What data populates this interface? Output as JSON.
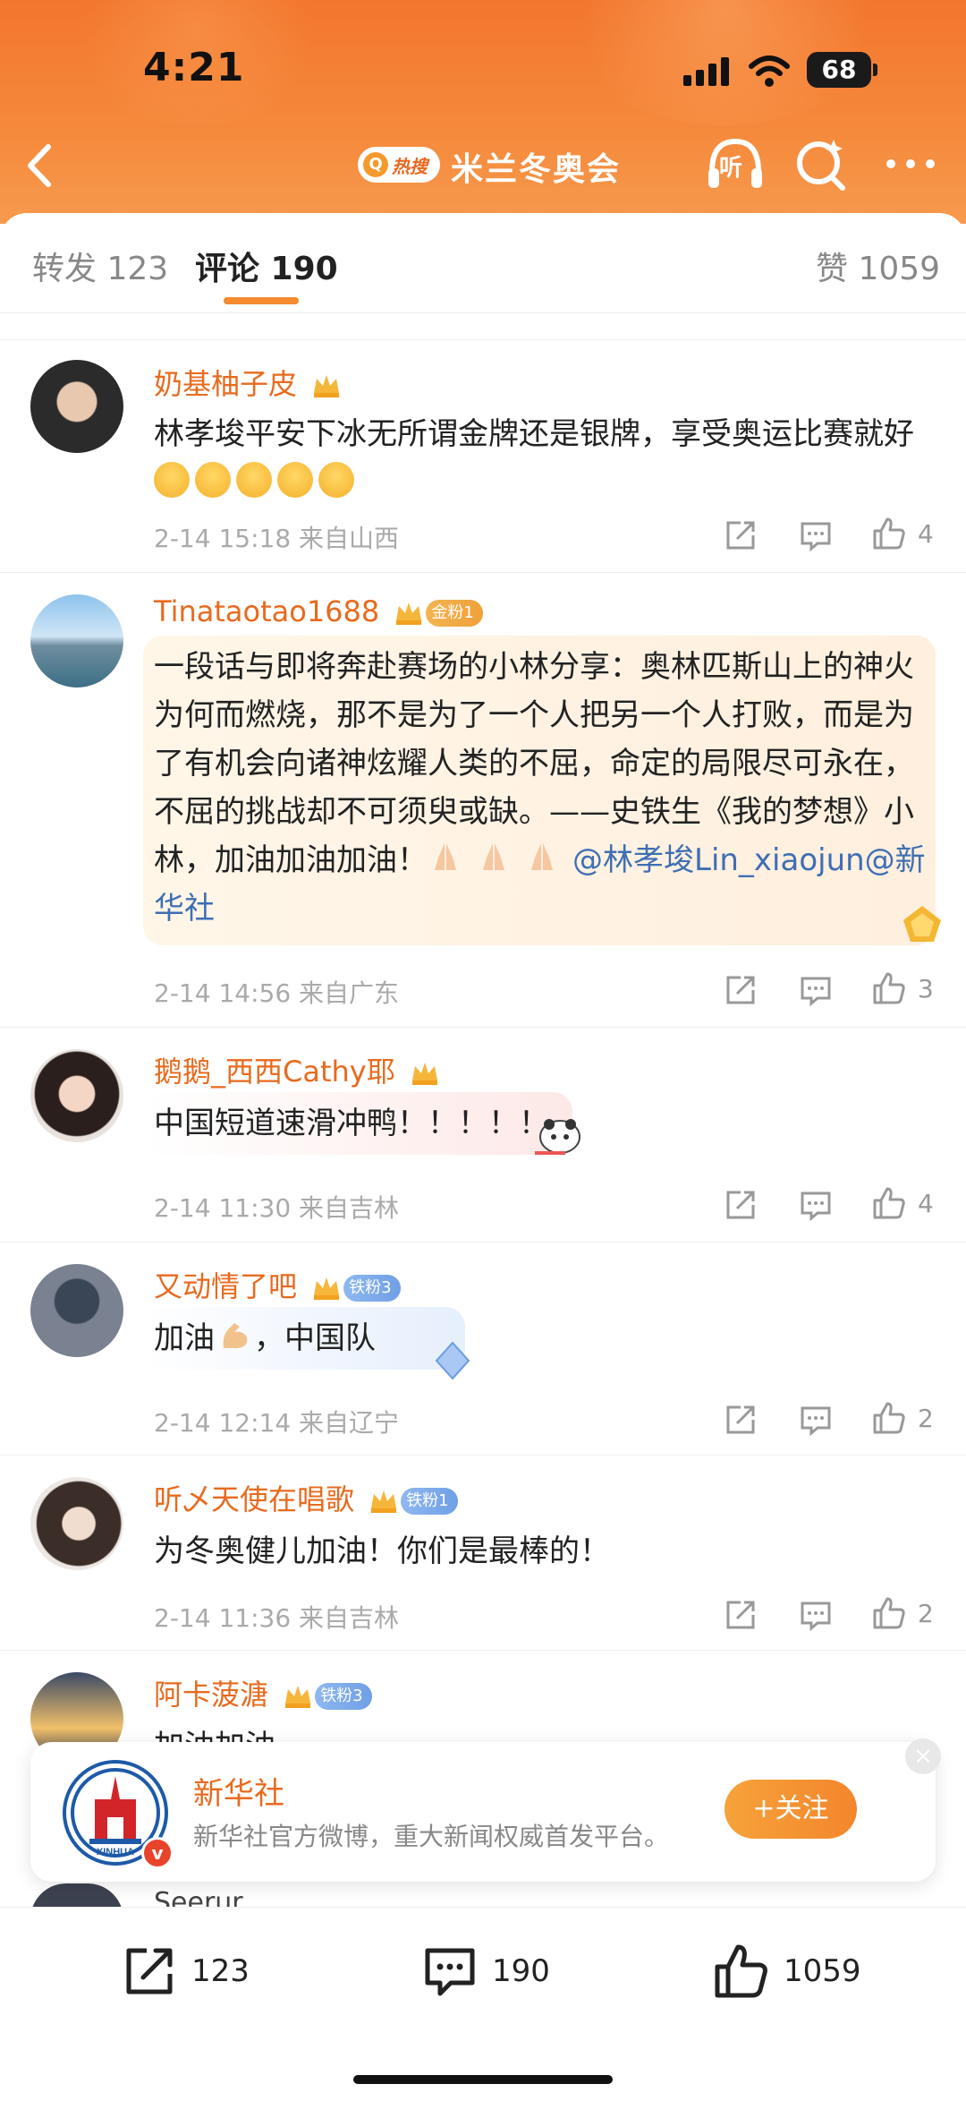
{
  "status": {
    "time": "4:21",
    "battery": "68"
  },
  "header": {
    "hot_badge": "热搜",
    "title": "米兰冬奥会",
    "listen_label": "听"
  },
  "tabs": {
    "repost": "转发 123",
    "comments": "评论 190",
    "likes": "赞 1059"
  },
  "comments": [
    {
      "user": "奶基柚子皮",
      "text": "林孝埈平安下冰无所谓金牌还是银牌，享受奥运比赛就好",
      "meta": "2-14 15:18  来自山西",
      "likes": "4"
    },
    {
      "user": "Tinataotao1688",
      "badge": "金粉1",
      "text_before": "一段话与即将奔赴赛场的小林分享：奥林匹斯山上的神火为何而燃烧，那不是为了一个人把另一个人打败，而是为了有机会向诸神炫耀人类的不屈，命定的局限尽可永在，不屈的挑战却不可须臾或缺。——史铁生《我的梦想》小林，加油加油加油！",
      "mention": "@林孝埈Lin_xiaojun@新华社",
      "meta": "2-14 14:56  来自广东",
      "likes": "3"
    },
    {
      "user": "鹅鹅_西西Cathy耶",
      "text": "中国短道速滑冲鸭！！！！！",
      "meta": "2-14 11:30  来自吉林",
      "likes": "4"
    },
    {
      "user": "又动情了吧",
      "badge": "铁粉3",
      "text_a": "加油",
      "text_b": "，中国队",
      "meta": "2-14 12:14  来自辽宁",
      "likes": "2"
    },
    {
      "user": "听乄天使在唱歌",
      "badge": "铁粉1",
      "text": "为冬奥健儿加油！你们是最棒的！",
      "meta": "2-14 11:36  来自吉林",
      "likes": "2"
    },
    {
      "user": "阿卡菠溏",
      "badge": "铁粉3",
      "text": "加油加油"
    }
  ],
  "partial_next_user": "Seerur",
  "promo": {
    "name": "新华社",
    "desc": "新华社官方微博，重大新闻权威首发平台。",
    "follow": "+关注",
    "logo_text": "XINHUA"
  },
  "bottom": {
    "reposts": "123",
    "comments": "190",
    "likes": "1059"
  },
  "colors": {
    "accent": "#f3862c",
    "username": "#e86a1e",
    "mention": "#3f6fb3"
  }
}
